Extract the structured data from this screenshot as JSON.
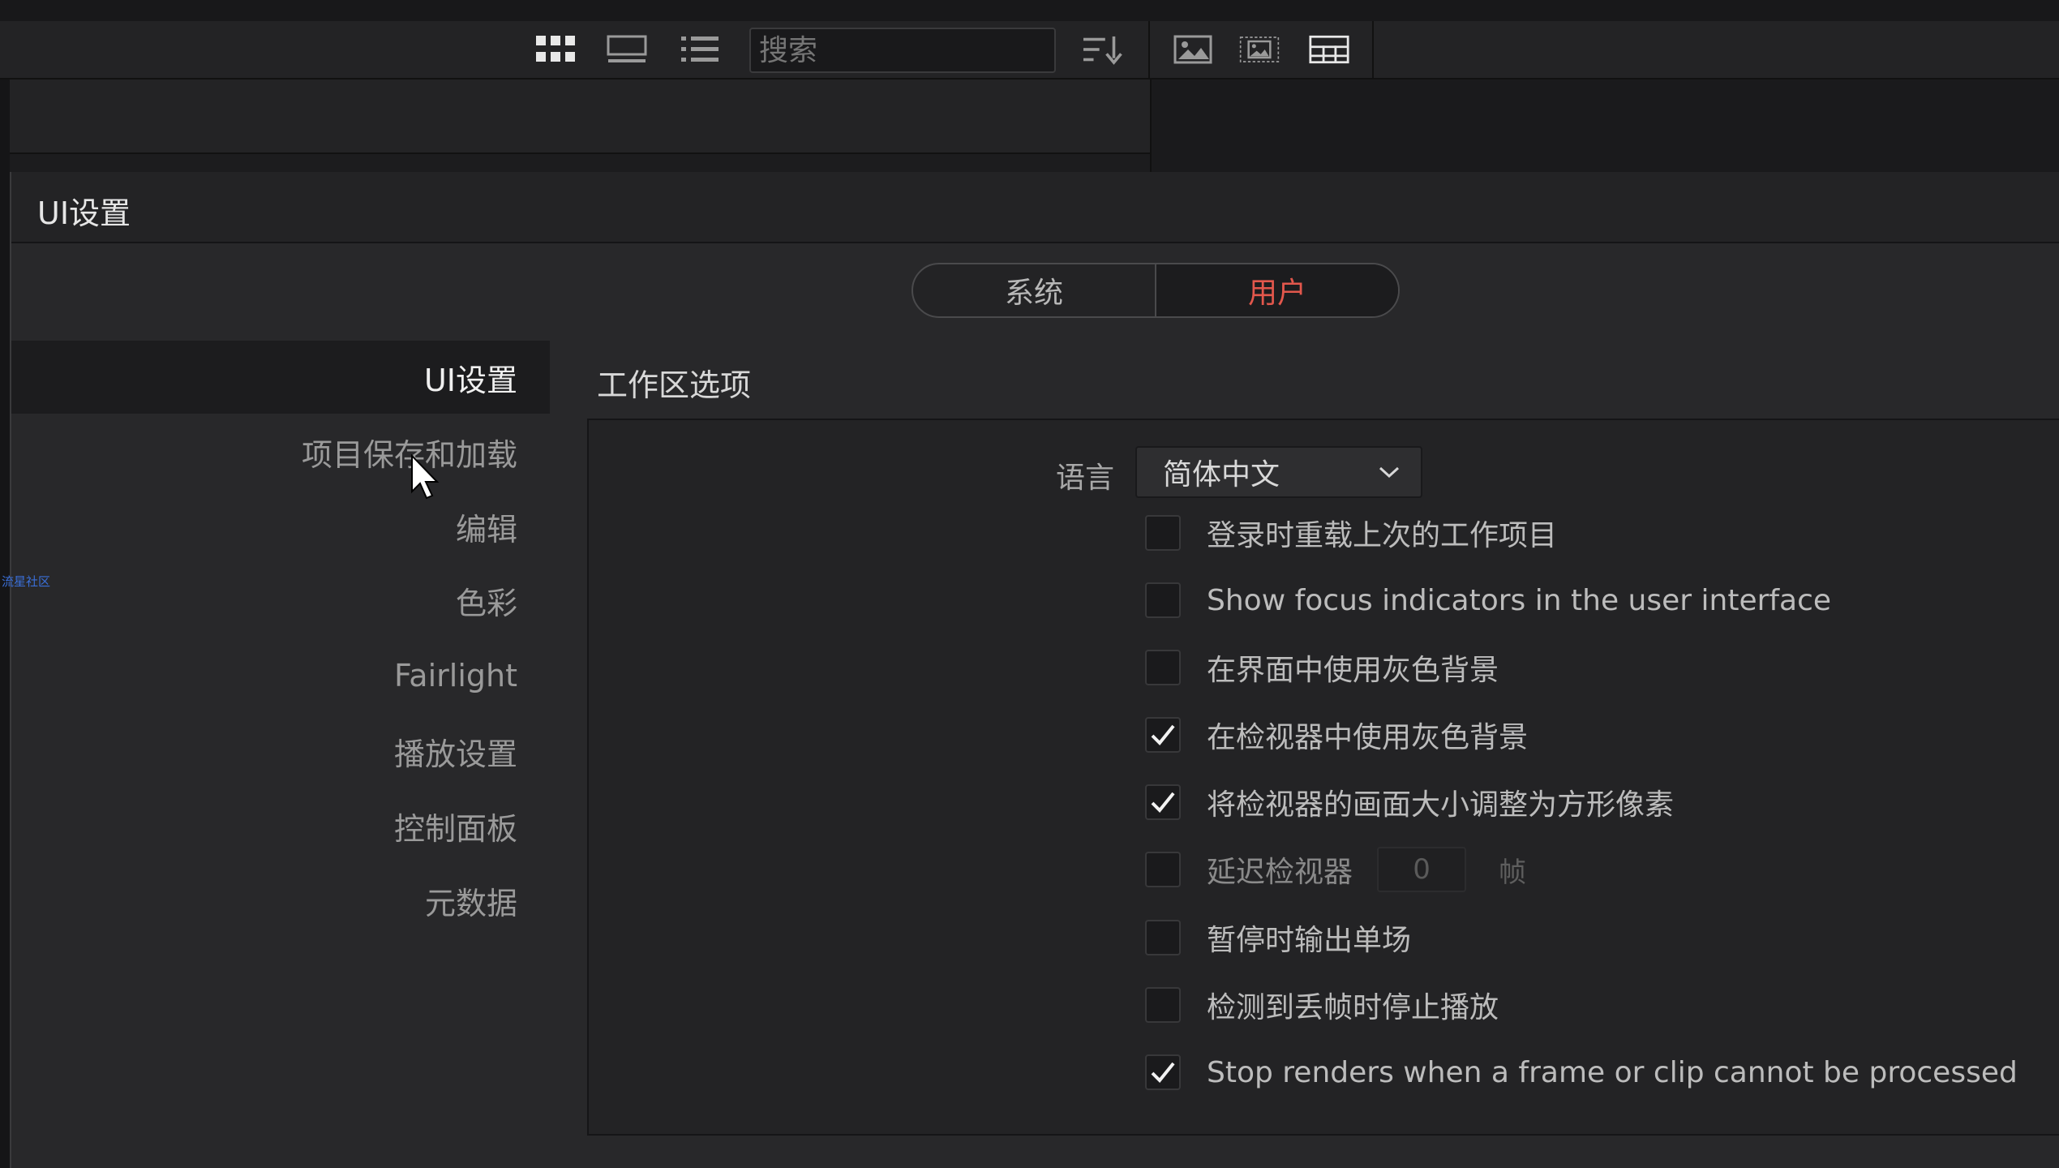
{
  "toolbar": {
    "icons": [
      "grid-view-icon",
      "strip-view-icon",
      "list-view-icon",
      "sort-icon",
      "image-icon",
      "image-frame-icon",
      "layout-icon"
    ],
    "search_placeholder": "搜索"
  },
  "dialog": {
    "title": "UI设置"
  },
  "tabs": {
    "system": "系统",
    "user": "用户",
    "active": "user",
    "active_color": "#e2574c"
  },
  "sidebar": {
    "items": [
      {
        "label": "UI设置",
        "active": true
      },
      {
        "label": "项目保存和加载",
        "active": false
      },
      {
        "label": "编辑",
        "active": false
      },
      {
        "label": "色彩",
        "active": false
      },
      {
        "label": "Fairlight",
        "active": false
      },
      {
        "label": "播放设置",
        "active": false
      },
      {
        "label": "控制面板",
        "active": false
      },
      {
        "label": "元数据",
        "active": false
      }
    ]
  },
  "workspace": {
    "section_title": "工作区选项",
    "language_label": "语言",
    "language_value": "简体中文",
    "options": [
      {
        "label": "登录时重载上次的工作项目",
        "checked": false
      },
      {
        "label": "Show focus indicators in the user interface",
        "checked": false
      },
      {
        "label": "在界面中使用灰色背景",
        "checked": false
      },
      {
        "label": "在检视器中使用灰色背景",
        "checked": true
      },
      {
        "label": "将检视器的画面大小调整为方形像素",
        "checked": true
      },
      {
        "label": "延迟检视器",
        "checked": false,
        "value": "0",
        "unit": "帧",
        "disabled": true
      },
      {
        "label": "暂停时输出单场",
        "checked": false
      },
      {
        "label": "检测到丢帧时停止播放",
        "checked": false
      },
      {
        "label": "Stop renders when a frame or clip cannot be processed",
        "checked": true
      }
    ]
  },
  "watermark": "流星社区"
}
